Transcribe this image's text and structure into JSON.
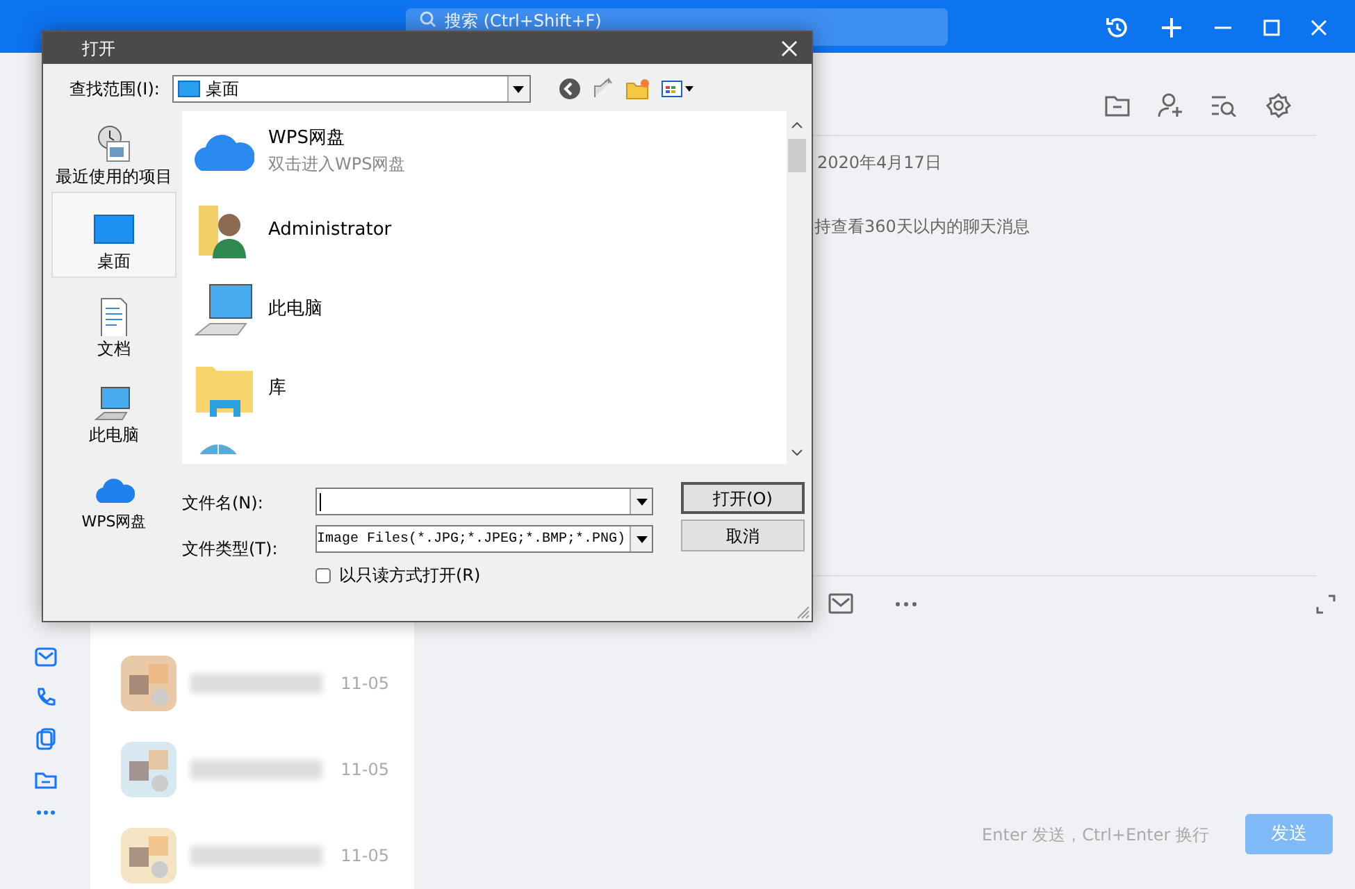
{
  "topbar": {
    "search_placeholder": "搜索 (Ctrl+Shift+F)"
  },
  "chat_list": [
    {
      "time": "11-05"
    },
    {
      "time": "11-05"
    },
    {
      "time": "11-05"
    }
  ],
  "chat": {
    "date": "2020年4月17日",
    "notice": "持查看360天以内的聊天消息",
    "input_hint": "Enter 发送，Ctrl+Enter 换行",
    "send_button": "发送"
  },
  "dialog": {
    "title": "打开",
    "look_in_label": "查找范围(I):",
    "look_in_value": "桌面",
    "places": [
      {
        "label": "最近使用的项目",
        "kind": "recent",
        "selected": false
      },
      {
        "label": "桌面",
        "kind": "desktop",
        "selected": true
      },
      {
        "label": "文档",
        "kind": "documents",
        "selected": false
      },
      {
        "label": "此电脑",
        "kind": "computer",
        "selected": false
      },
      {
        "label": "WPS网盘",
        "kind": "cloud",
        "selected": false
      }
    ],
    "files": [
      {
        "name": "WPS网盘",
        "subtitle": "双击进入WPS网盘",
        "kind": "cloud"
      },
      {
        "name": "Administrator",
        "kind": "user"
      },
      {
        "name": "此电脑",
        "kind": "computer"
      },
      {
        "name": "库",
        "kind": "library"
      },
      {
        "kind": "network"
      }
    ],
    "file_name_label": "文件名(N):",
    "file_type_label": "文件类型(T):",
    "file_type_value": "Image Files(*.JPG;*.JPEG;*.BMP;*.PNG)",
    "read_only": {
      "label": "以只读方式打开(R)",
      "checked": false
    },
    "buttons": [
      {
        "label": "打开(O)",
        "kind": "default"
      },
      {
        "label": "取消",
        "kind": "cancel"
      }
    ]
  }
}
